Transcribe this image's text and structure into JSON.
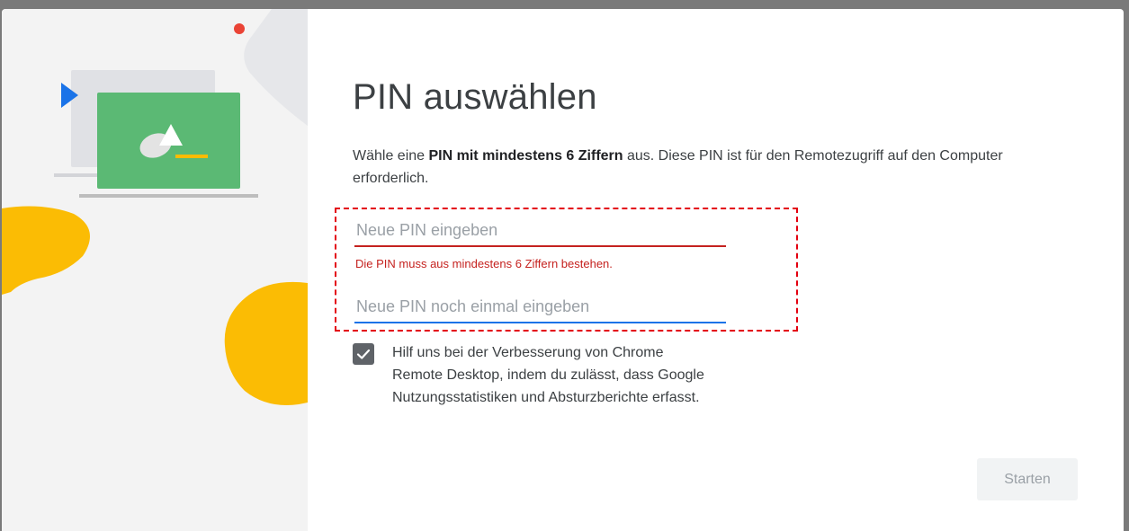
{
  "dialog": {
    "title": "PIN auswählen",
    "description": {
      "prefix": "Wähle eine ",
      "bold": "PIN mit mindestens 6 Ziffern",
      "suffix": " aus. Diese PIN ist für den Remotezugriff auf den Computer erforderlich."
    },
    "pin_field": {
      "placeholder": "Neue PIN eingeben",
      "value": "",
      "error": "Die PIN muss aus mindestens 6 Ziffern bestehen."
    },
    "pin_confirm_field": {
      "placeholder": "Neue PIN noch einmal eingeben",
      "value": ""
    },
    "consent": {
      "checked": true,
      "label": "Hilf uns bei der Verbesserung von Chrome Remote Desktop, indem du zulässt, dass Google Nutzungsstatistiken und Absturzberichte erfasst."
    },
    "start_button": {
      "label": "Starten",
      "enabled": false
    }
  },
  "illustration": {
    "icons": [
      "laptop-icon",
      "play-triangle-icon",
      "red-dot-icon",
      "yellow-blob-icon"
    ]
  },
  "colors": {
    "error": "#c5221f",
    "focus": "#1a73e8",
    "highlight": "#e3000f",
    "green": "#5bb974",
    "yellow": "#fbbc04",
    "blue": "#1a73e8",
    "red": "#ea4335"
  }
}
